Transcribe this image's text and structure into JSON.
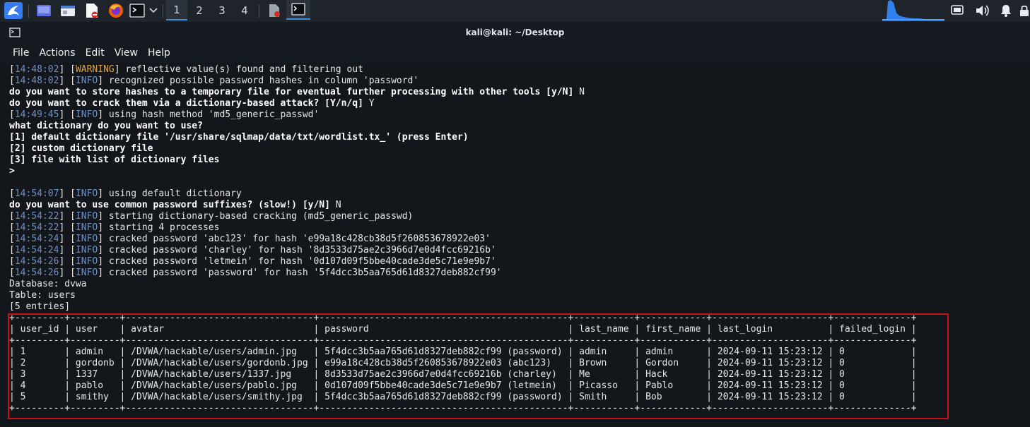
{
  "panel": {
    "workspaces": [
      "1",
      "2",
      "3",
      "4"
    ],
    "active_workspace": "1"
  },
  "window": {
    "title": "kali@kali: ~/Desktop"
  },
  "menu": [
    "File",
    "Actions",
    "Edit",
    "View",
    "Help"
  ],
  "terminal": {
    "lines": [
      {
        "time": "14:48:02",
        "level": "WARNING",
        "text": "reflective value(s) found and filtering out"
      },
      {
        "time": "14:48:02",
        "level": "INFO",
        "text": "recognized possible password hashes in column 'password'"
      },
      {
        "prompt": "do you want to store hashes to a temporary file for eventual further processing with other tools [y/N]",
        "answer": "N"
      },
      {
        "prompt": "do you want to crack them via a dictionary-based attack? [Y/n/q]",
        "answer": "Y"
      },
      {
        "time": "14:49:45",
        "level": "INFO",
        "text": "using hash method 'md5_generic_passwd'"
      },
      {
        "prompt": "what dictionary do you want to use?"
      },
      {
        "prompt": "[1] default dictionary file '/usr/share/sqlmap/data/txt/wordlist.tx_' (press Enter)"
      },
      {
        "prompt": "[2] custom dictionary file"
      },
      {
        "prompt": "[3] file with list of dictionary files"
      },
      {
        "prompt": ">"
      },
      {
        "text": ""
      },
      {
        "time": "14:54:07",
        "level": "INFO",
        "text": "using default dictionary"
      },
      {
        "prompt": "do you want to use common password suffixes? (slow!) [y/N]",
        "answer": "N"
      },
      {
        "time": "14:54:22",
        "level": "INFO",
        "text": "starting dictionary-based cracking (md5_generic_passwd)"
      },
      {
        "time": "14:54:22",
        "level": "INFO",
        "text": "starting 4 processes"
      },
      {
        "time": "14:54:24",
        "level": "INFO",
        "text": "cracked password 'abc123' for hash 'e99a18c428cb38d5f260853678922e03'"
      },
      {
        "time": "14:54:24",
        "level": "INFO",
        "text": "cracked password 'charley' for hash '8d3533d75ae2c3966d7e0d4fcc69216b'"
      },
      {
        "time": "14:54:26",
        "level": "INFO",
        "text": "cracked password 'letmein' for hash '0d107d09f5bbe40cade3de5c71e9e9b7'"
      },
      {
        "time": "14:54:26",
        "level": "INFO",
        "text": "cracked password 'password' for hash '5f4dcc3b5aa765d61d8327deb882cf99'"
      },
      {
        "text": "Database: dvwa"
      },
      {
        "text": "Table: users"
      },
      {
        "text": "[5 entries]"
      }
    ],
    "table": {
      "columns": [
        "user_id",
        "user",
        "avatar",
        "password",
        "last_name",
        "first_name",
        "last_login",
        "failed_login"
      ],
      "rows": [
        [
          "1",
          "admin",
          "/DVWA/hackable/users/admin.jpg",
          "5f4dcc3b5aa765d61d8327deb882cf99 (password)",
          "admin",
          "admin",
          "2024-09-11 15:23:12",
          "0"
        ],
        [
          "2",
          "gordonb",
          "/DVWA/hackable/users/gordonb.jpg",
          "e99a18c428cb38d5f260853678922e03 (abc123)",
          "Brown",
          "Gordon",
          "2024-09-11 15:23:12",
          "0"
        ],
        [
          "3",
          "1337",
          "/DVWA/hackable/users/1337.jpg",
          "8d3533d75ae2c3966d7e0d4fcc69216b (charley)",
          "Me",
          "Hack",
          "2024-09-11 15:23:12",
          "0"
        ],
        [
          "4",
          "pablo",
          "/DVWA/hackable/users/pablo.jpg",
          "0d107d09f5bbe40cade3de5c71e9e9b7 (letmein)",
          "Picasso",
          "Pablo",
          "2024-09-11 15:23:12",
          "0"
        ],
        [
          "5",
          "smithy",
          "/DVWA/hackable/users/smithy.jpg",
          "5f4dcc3b5aa765d61d8327deb882cf99 (password)",
          "Smith",
          "Bob",
          "2024-09-11 15:23:12",
          "0"
        ]
      ]
    },
    "colors": {
      "background": "#13171c",
      "timestamp": "#6d8fc7",
      "warning": "#e0a040",
      "highlight_box": "#c4121a"
    }
  }
}
